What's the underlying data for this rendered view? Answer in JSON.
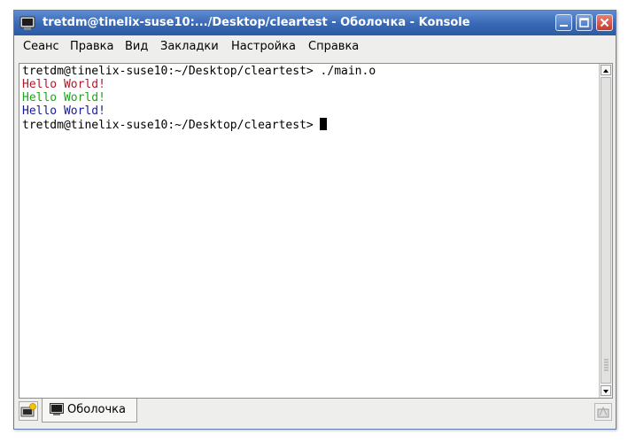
{
  "window": {
    "title": "tretdm@tinelix-suse10:.../Desktop/cleartest - Оболочка - Konsole",
    "icon": "konsole-terminal-icon"
  },
  "menubar": {
    "items": [
      "Сеанс",
      "Правка",
      "Вид",
      "Закладки",
      "Настройка",
      "Справка"
    ]
  },
  "terminal": {
    "lines": [
      {
        "text": "tretdm@tinelix-suse10:~/Desktop/cleartest> ./main.o",
        "color": "#000000"
      },
      {
        "text": "Hello World!",
        "color": "#b2182b"
      },
      {
        "text": "Hello World!",
        "color": "#18a818"
      },
      {
        "text": "Hello World!",
        "color": "#1a1a9c"
      },
      {
        "text": "tretdm@tinelix-suse10:~/Desktop/cleartest>",
        "color": "#000000"
      }
    ]
  },
  "tabs": [
    {
      "label": "Оболочка",
      "icon": "terminal-icon"
    }
  ],
  "colors": {
    "titlebar": "#3868b5",
    "close_button": "#c83a2a",
    "terminal_background": "#ffffff"
  }
}
